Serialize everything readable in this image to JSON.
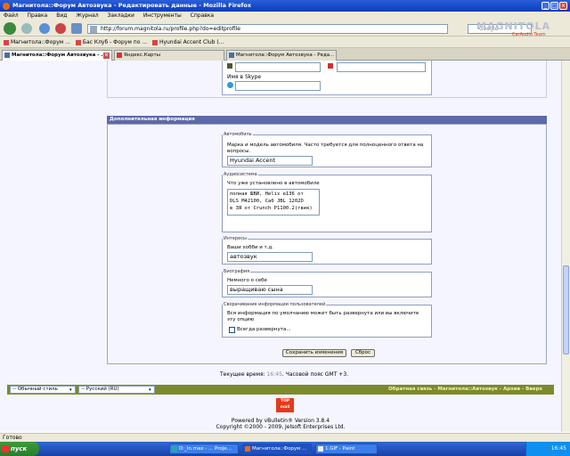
{
  "window": {
    "title": "Магнитола::Форум Автозвука - Редактировать данные - Mozilla Firefox"
  },
  "menu": [
    "Файл",
    "Правка",
    "Вид",
    "Журнал",
    "Закладки",
    "Инструменты",
    "Справка"
  ],
  "nav": {
    "url": "http://forum.magnitola.ru/profile.php?do=editprofile",
    "search_placeholder": "Google"
  },
  "bookmarks": [
    "Магнитола::Форум ...",
    "Бас Клуб - Форум по ...",
    "Hyundai Accent Club (..."
  ],
  "tabs": [
    {
      "label": "Магнитола::Форум Автозвука - ..."
    },
    {
      "label": "Яндекс.Карты"
    },
    {
      "label": "Магнитола::Форум Автозвука - Реда..."
    }
  ],
  "logo": {
    "text": "MAGNITOLA",
    "sub": "CarAudio Team"
  },
  "profile": {
    "skype_label": "Имя в Skype"
  },
  "section": {
    "title": "Дополнительная информация"
  },
  "car": {
    "legend": "Автомобиль",
    "description": "Марка и модель автомобиля. Часто требуется для полноценного ответа на вопросы.",
    "value": "Hyundai Accent"
  },
  "audio": {
    "legend": "Аудиосистема",
    "description": "Что уже установлено в автомобиле",
    "lines": [
      "полная ШВИ, Helix e136 от",
      "DLS M42100, Саб JBL 1202D",
      "в ЗЯ от Crunch P1100.2(твик)"
    ]
  },
  "interests": {
    "legend": "Интересы",
    "description": "Ваши хобби и т.д.",
    "value": "автозвук"
  },
  "bio": {
    "legend": "Биография",
    "description": "Немного о себе",
    "value": "выращиваю сына"
  },
  "collapse": {
    "legend": "Сворачивание информации пользователей",
    "description": "Вся информация по умолчанию может быть развернута или вы включите эту опцию",
    "checkbox_label": "Всегда развернута..."
  },
  "buttons": {
    "save": "Сохранить изменения",
    "reset": "Сброс"
  },
  "time": {
    "prefix": "Текущее время:",
    "value": "16:45",
    "suffix": ". Часовой пояс GMT +3."
  },
  "footer": {
    "style_select": "-- Обычный стиль",
    "lang_select": "-- Русский (RU)",
    "links": "Обратная связь - Магнитола::Автозвук - Архив - Вверх",
    "badge": "TOP mail",
    "powered": "Powered by vBulletin® Version 3.8.4",
    "copyright": "Copyright ©2000 - 2009, Jelsoft Enterprises Ltd."
  },
  "status": {
    "text": "Готово"
  },
  "taskbar": {
    "start": "пуск",
    "tasks": [
      "D:_ln.max - ... Proje...",
      "Магнитола::Форум ...",
      "1.GIF - Paint"
    ],
    "clock": "16:45"
  },
  "colors": {
    "title_bar": "#0a3cbb",
    "section_header": "#5c6aa8",
    "footer_bar": "#7d8a2a",
    "footer_links": "#f0f6b0"
  }
}
